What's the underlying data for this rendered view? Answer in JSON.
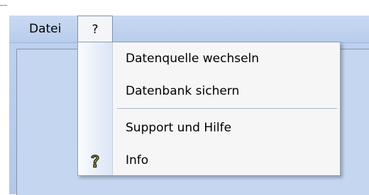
{
  "menubar": {
    "file_label": "Datei",
    "help_label": "?"
  },
  "help_menu": {
    "items": [
      {
        "label": "Datenquelle wechseln"
      },
      {
        "label": "Datenbank sichern"
      },
      {
        "label": "Support und Hilfe"
      },
      {
        "label": "Info",
        "icon": "question-mark-icon"
      }
    ]
  },
  "colors": {
    "menubar": "#c9d9f2",
    "client": "#c5d6f1",
    "dropdown": "#f6f6f6",
    "icon_yellow": "#f2d000"
  }
}
